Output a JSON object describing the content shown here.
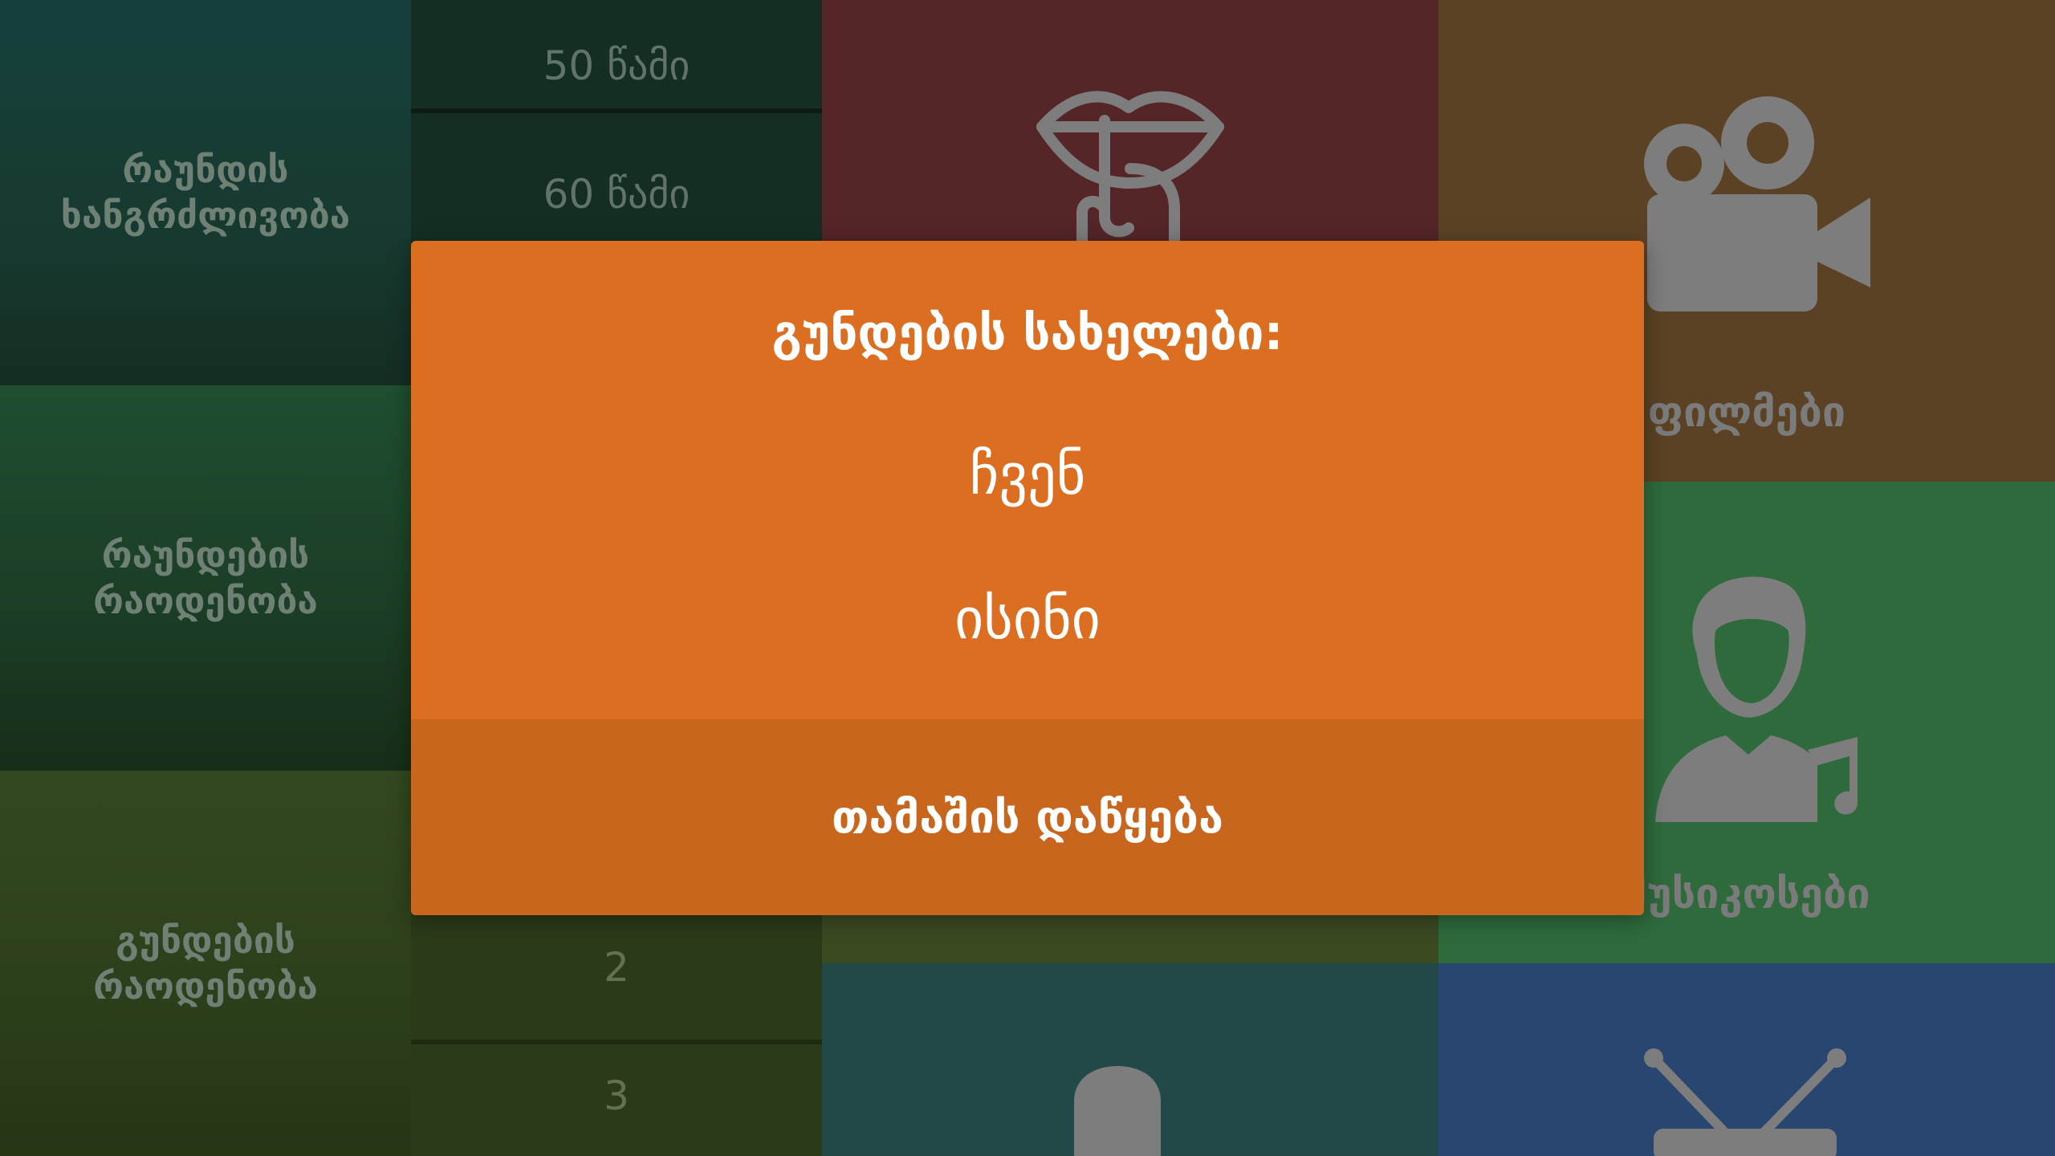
{
  "settings": {
    "round_duration_label": "რაუნდის\nხანგრძლივობა",
    "round_count_label": "რაუნდების\nრაოდენობა",
    "team_count_label": "გუნდების\nრაოდენობა"
  },
  "picker_time": {
    "options": [
      "50 წამი",
      "60 წამი"
    ]
  },
  "picker_teams": {
    "options": [
      "2",
      "3"
    ]
  },
  "tiles": {
    "films_label": "ფილმები",
    "music_label": "მუსიკოსები"
  },
  "modal": {
    "title": "გუნდების სახელები:",
    "team_1": "ჩვენ",
    "team_2": "ისინი",
    "start_button": "თამაშის დაწყება"
  },
  "icons": {
    "tile_red": "silence-lips-icon",
    "tile_films": "movie-camera-icon",
    "tile_music": "musician-icon",
    "tile_teal": "person-icon",
    "tile_tv": "tv-icon"
  },
  "colors": {
    "modal_bg": "#db6e20",
    "start_button_bg": "#c9661e"
  }
}
